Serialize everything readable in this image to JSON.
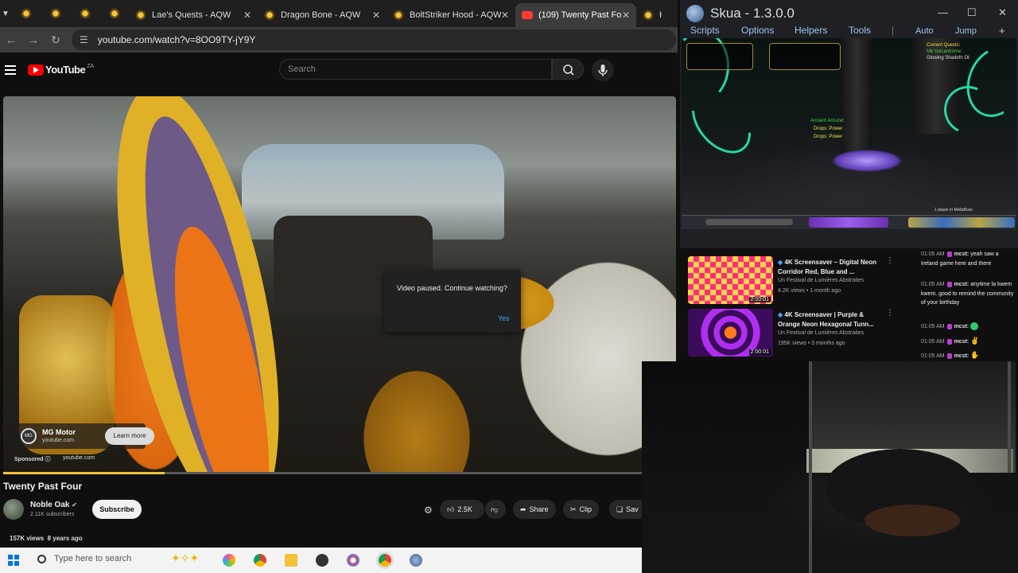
{
  "browser": {
    "tabs": [
      {
        "label": "Lae's Quests - AQW",
        "active": false
      },
      {
        "label": "Dragon Bone - AQW",
        "active": false
      },
      {
        "label": "BoltStriker Hood - AQW",
        "active": false
      },
      {
        "label": "(109) Twenty Past Fo",
        "active": true
      },
      {
        "label": "Hol",
        "active": false
      }
    ],
    "url": "youtube.com/watch?v=8OO9TY-jY9Y"
  },
  "youtube": {
    "logo": "YouTube",
    "country": "ZA",
    "search_placeholder": "Search",
    "pause_dialog": {
      "text": "Video paused. Continue watching?",
      "yes": "Yes"
    },
    "ad": {
      "logo_text": "MG",
      "title": "MG Motor",
      "domain": "youtube.com",
      "learn_more": "Learn more",
      "sponsored": "Sponsored",
      "sponsored_domain": "youtube.com"
    },
    "progress": 0.24,
    "video_title": "Twenty Past Four",
    "channel": {
      "name": "Noble Oak",
      "subscribers": "2.11K subscribers",
      "subscribe": "Subscribe"
    },
    "actions": {
      "likes": "2.5K",
      "share": "Share",
      "clip": "Clip",
      "save": "Sav"
    },
    "description": {
      "views": "157K views",
      "age": "8 years ago"
    }
  },
  "taskbar": {
    "search_placeholder": "Type here to search"
  },
  "skua": {
    "title": "Skua - 1.3.0.0",
    "menu": [
      "Scripts",
      "Options",
      "Helpers",
      "Tools",
      "Auto",
      "Jump"
    ],
    "game": {
      "quest_header": "Current Quests:",
      "quest_lines": [
        "Mb Vulcantrome",
        "Glowing Shadefn Ot"
      ],
      "loot": [
        "Ancient Amuzet",
        "Drops: Power",
        "Drops: Power"
      ],
      "player_count": "1 player in MeltaBoss"
    }
  },
  "related": [
    {
      "title": "4K Screensaver – Digital Neon Corridor Red, Blue and ...",
      "channel": "Un Festival de Lumières Abstraites",
      "meta": "4.2K views • 1 month ago",
      "duration": "2:00:01",
      "colors": [
        "#ff2d7a",
        "#1a1a60",
        "#ffd34d"
      ]
    },
    {
      "title": "4K Screensaver | Purple & Orange Neon Hexagonal Tunn...",
      "channel": "Un Festival de Lumières Abstraites",
      "meta": "195K views • 3 months ago",
      "duration": "2:00:01",
      "colors": [
        "#b02ef0",
        "#ff7a1a",
        "#3b0b5c"
      ]
    }
  ],
  "chat": [
    {
      "time": "01:05 AM",
      "user": "mcst:",
      "text": "yeah saw a Ireland game here and there"
    },
    {
      "time": "01:05 AM",
      "user": "mcst:",
      "text": "anytime la kwem kwem. good to remind the community of your birthday"
    },
    {
      "time": "01:05 AM",
      "user": "mcst:",
      "text": ""
    },
    {
      "time": "01:05 AM",
      "user": "mcst:",
      "text": ""
    },
    {
      "time": "01:05 AM",
      "user": "mcst:",
      "text": ""
    }
  ]
}
